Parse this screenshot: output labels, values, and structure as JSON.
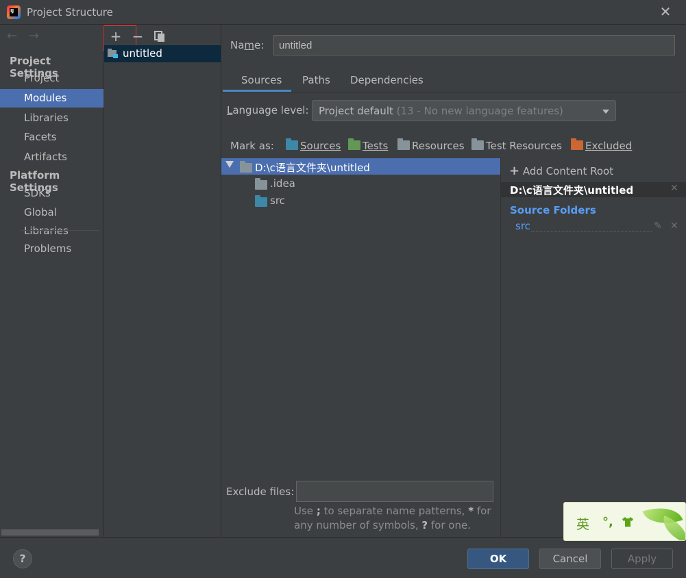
{
  "window": {
    "title": "Project Structure",
    "close_symbol": "✕"
  },
  "nav": {
    "back_icon": "arrow-left-icon",
    "forward_icon": "arrow-right-icon",
    "project_settings_header": "Project Settings",
    "project_settings_items": [
      "Project",
      "Modules",
      "Libraries",
      "Facets",
      "Artifacts"
    ],
    "platform_settings_header": "Platform Settings",
    "platform_settings_items": [
      "SDKs",
      "Global Libraries"
    ],
    "problems": "Problems",
    "selected": "Modules"
  },
  "modules": {
    "toolbar": {
      "add": "+",
      "remove": "−",
      "copy_icon": "copy-icon"
    },
    "list": [
      "untitled"
    ]
  },
  "module": {
    "name_label": "Name:",
    "name_value": "untitled",
    "tabs": [
      "Sources",
      "Paths",
      "Dependencies"
    ],
    "active_tab": "Sources",
    "language_level_label": "Language level:",
    "language_level_value": "Project default",
    "language_level_hint": "(13 - No new language features)",
    "mark_as_label": "Mark as:",
    "mark_as": [
      {
        "label": "Sources",
        "color": "#3d87a7"
      },
      {
        "label": "Tests",
        "color": "#629755"
      },
      {
        "label": "Resources",
        "color": "#87939a"
      },
      {
        "label": "Test Resources",
        "color": "#87939a"
      },
      {
        "label": "Excluded",
        "color": "#cc6633"
      }
    ],
    "tree": {
      "root": "D:\\c语言文件夹\\untitled",
      "children": [
        ".idea",
        "src"
      ]
    },
    "content_root": {
      "add_label": "Add Content Root",
      "path": "D:\\c语言文件夹\\untitled",
      "source_folders_header": "Source Folders",
      "source_folders": [
        "src"
      ]
    },
    "exclude_files_label": "Exclude files:",
    "exclude_files_value": "",
    "hint_line1_pre": "Use",
    "hint_line1_sym": ";",
    "hint_line1_post": "to separate name patterns,",
    "hint_line1_star": "*",
    "hint_line1_for": "for",
    "hint_line2_pre": "any number of symbols,",
    "hint_line2_q": "?",
    "hint_line2_post": "for one."
  },
  "buttons": {
    "help": "?",
    "ok": "OK",
    "cancel": "Cancel",
    "apply": "Apply"
  },
  "ime": {
    "mode_char": "英",
    "punct": "°,",
    "shirt_icon": "shirt-icon"
  },
  "colors": {
    "accent": "#4b6eaf",
    "folder_gray": "#87939a",
    "folder_blue": "#3d87a7",
    "link_blue": "#589df6"
  }
}
